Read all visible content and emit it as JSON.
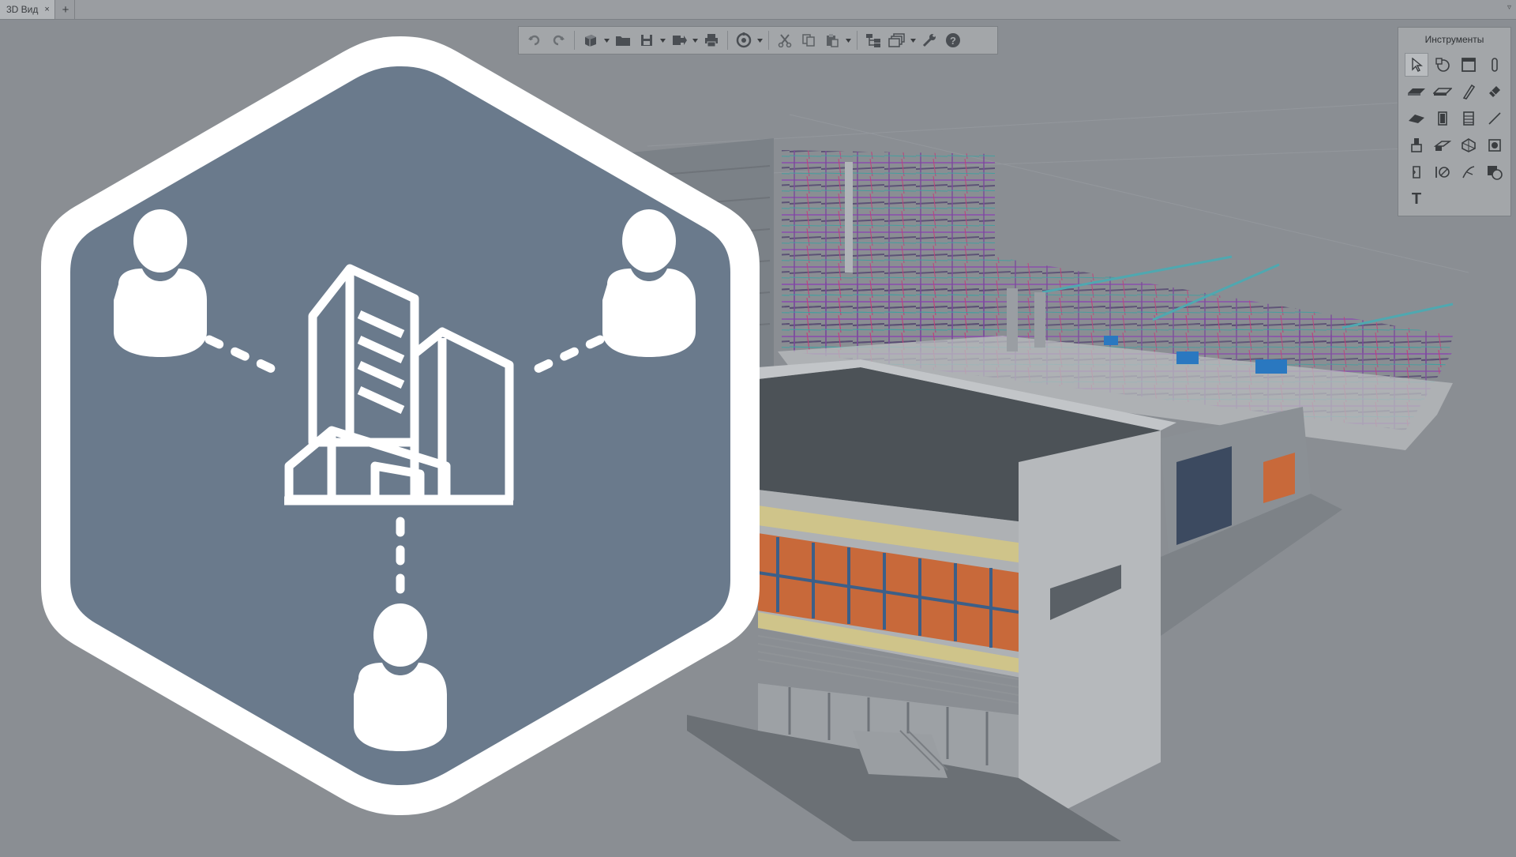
{
  "tab": {
    "title": "3D Вид",
    "close": "×",
    "add": "+",
    "menu": "▿"
  },
  "toolbar": {
    "buttons": [
      "undo-icon",
      "redo-icon",
      "view-cube-icon",
      "open-folder-icon",
      "save-icon",
      "export-icon",
      "print-icon",
      "orbit-icon",
      "cut-icon",
      "copy-icon",
      "paste-icon",
      "structure-icon",
      "layers-icon",
      "wrench-icon",
      "help-icon"
    ]
  },
  "tools": {
    "title": "Инструменты",
    "text_tool": "T"
  },
  "colors": {
    "hex_fill": "#6a7a8c",
    "hex_border": "#ffffff",
    "background": "#8a8e93",
    "accent_orange": "#c8693a",
    "mep_purple": "#8a5aa8",
    "mep_blue": "#2a78c0"
  }
}
